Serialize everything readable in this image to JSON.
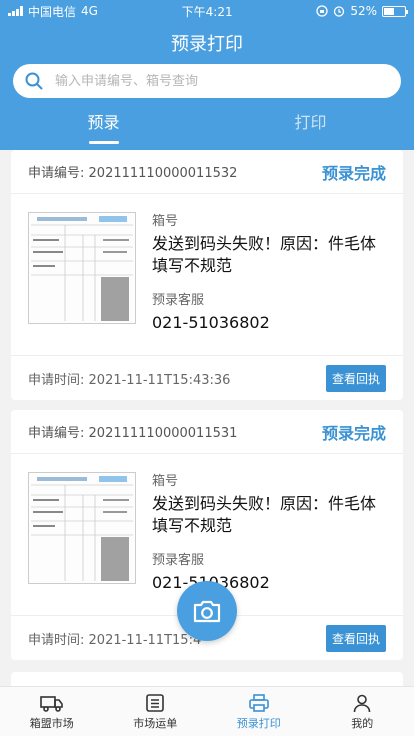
{
  "status_bar": {
    "carrier": "中国电信",
    "network": "4G",
    "time": "下午4:21",
    "battery": "52%",
    "battery_level": 0.52
  },
  "header": {
    "title": "预录打印"
  },
  "search": {
    "placeholder": "输入申请编号、箱号查询"
  },
  "tabs": [
    {
      "label": "预录"
    },
    {
      "label": "打印"
    }
  ],
  "cards": [
    {
      "app_no_label": "申请编号:",
      "app_no": "202111110000011532",
      "status": "预录完成",
      "box_label": "箱号",
      "box_value": "发送到码头失败！原因：件毛体填写不规范",
      "service_label": "预录客服",
      "service_phone": "021-51036802",
      "time_label": "申请时间:",
      "time": "2021-11-11T15:43:36",
      "receipt_btn": "查看回执"
    },
    {
      "app_no_label": "申请编号:",
      "app_no": "202111110000011531",
      "status": "预录完成",
      "box_label": "箱号",
      "box_value": "发送到码头失败！原因：件毛体填写不规范",
      "service_label": "预录客服",
      "service_phone": "021-51036802",
      "time_label": "申请时间:",
      "time": "2021-11-11T15:4",
      "receipt_btn": "查看回执"
    }
  ],
  "tabbar": [
    {
      "label": "箱盟市场",
      "icon": "truck-icon"
    },
    {
      "label": "市场运单",
      "icon": "list-icon"
    },
    {
      "label": "预录打印",
      "icon": "printer-icon",
      "active": true
    },
    {
      "label": "我的",
      "icon": "user-icon"
    }
  ],
  "colors": {
    "primary": "#4a9fe0",
    "accent": "#3a92d4"
  }
}
